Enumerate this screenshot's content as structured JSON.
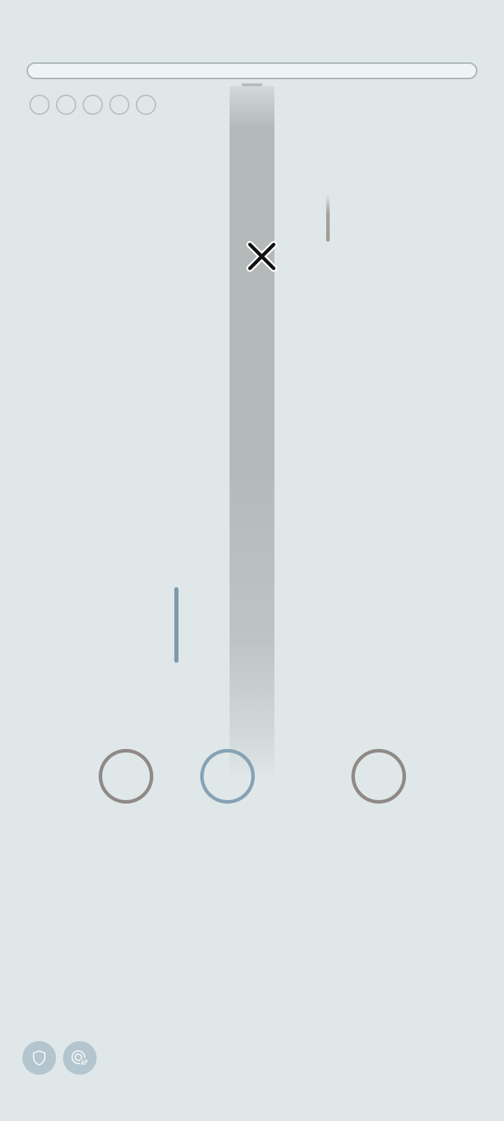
{
  "progress": {
    "value": 0
  },
  "lives": {
    "count": 5
  },
  "icons": {
    "miss": "close-icon",
    "shield": "shield-icon",
    "ap": "target-ap-icon"
  },
  "colors": {
    "background": "#dfe7e9",
    "lane": "#b3bab9",
    "ring_gray": "#8f8a86",
    "ring_blue": "#86a2b4",
    "note_blue": "#7f9bab",
    "button": "#b3c5cf"
  }
}
